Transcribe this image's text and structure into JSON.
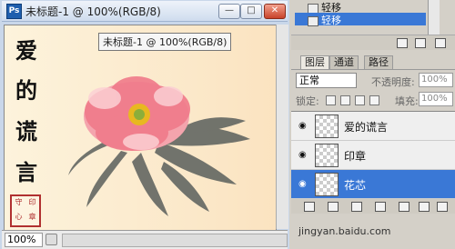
{
  "window": {
    "title": "未标题-1 @ 100%(RGB/8)",
    "minimize": "—",
    "restore": "□",
    "close": "✕"
  },
  "canvas": {
    "poem_chars": [
      "爱",
      "的",
      "谎",
      "言"
    ],
    "seal_chars": [
      "守",
      "印",
      "心",
      "章"
    ],
    "tooltip": "未标题-1 @ 100%(RGB/8)"
  },
  "status": {
    "zoom": "100%"
  },
  "history": {
    "items": [
      {
        "label": "轻移"
      },
      {
        "label": "轻移"
      }
    ]
  },
  "layers_panel": {
    "tabs": [
      "图层",
      "通道",
      "路径"
    ],
    "blend_mode": "正常",
    "opacity_label": "不透明度:",
    "opacity_value": "100%",
    "lock_label": "锁定:",
    "fill_label": "填充:",
    "fill_value": "100%",
    "layers": [
      {
        "name": "爱的谎言"
      },
      {
        "name": "印章"
      },
      {
        "name": "花芯"
      }
    ]
  },
  "watermark": "jingyan.baidu.com",
  "colors": {
    "selection": "#3a78d6",
    "canvas_bg": "#fbe8c9",
    "petal": "#f07a8a"
  }
}
